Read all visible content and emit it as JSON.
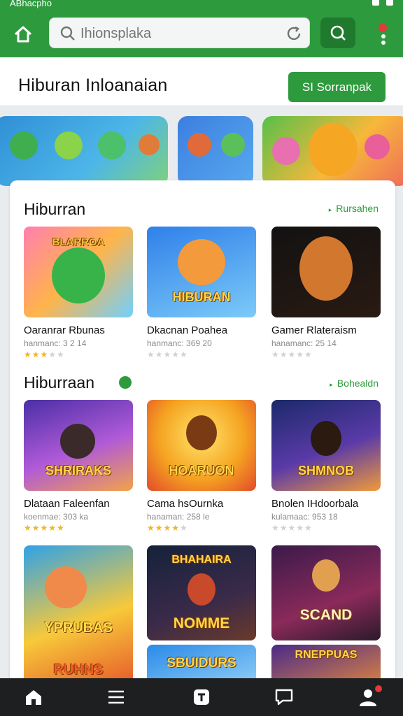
{
  "status_bar": {
    "text": "ABhacpho"
  },
  "search": {
    "placeholder": "Ihionsplaka"
  },
  "header": {
    "title": "Hiburan  Inloanaian",
    "cta_label": "SI Sorranpak"
  },
  "sections": [
    {
      "title": "Hiburran",
      "link": "Rursahen",
      "items": [
        {
          "name": "Oaranrar Rbunas",
          "meta": "hanmanc: 3 2 14",
          "rating": 3,
          "badge": "BLARROA"
        },
        {
          "name": "Dkacnan Poahea",
          "meta": "hanmanc: 369 20",
          "rating": 0,
          "badge": "HIBURAN"
        },
        {
          "name": "Gamer Rlateraism",
          "meta": "hanamanc: 25 14",
          "rating": 0,
          "badge": ""
        }
      ]
    },
    {
      "title": "Hiburraan",
      "link": "Bohealdn",
      "items": [
        {
          "name": "Dlataan Faleenfan",
          "meta": "koenmae: 303 ka",
          "rating": 5,
          "badge": "SHRIRAKS"
        },
        {
          "name": "Cama hsOurnka",
          "meta": "hanaman: 258 le",
          "rating": 4,
          "badge": "HOARUON"
        },
        {
          "name": "Bnolen IHdoorbala",
          "meta": "kulamaac: 953 18",
          "rating": 0,
          "badge": "SHMNOB"
        }
      ]
    },
    {
      "items": [
        {
          "badge": "YPRUBAS",
          "sub": "RUHNS"
        },
        {
          "badge": "NOMME",
          "top": "BHAHAIRA"
        },
        {
          "badge": "SCAND"
        },
        {
          "badge": "SBUIDURS"
        },
        {
          "badge": "RNEPPUAS"
        }
      ]
    }
  ],
  "nav": {
    "items": [
      "home-icon",
      "menu-icon",
      "store-icon",
      "chat-icon",
      "profile-icon"
    ]
  }
}
